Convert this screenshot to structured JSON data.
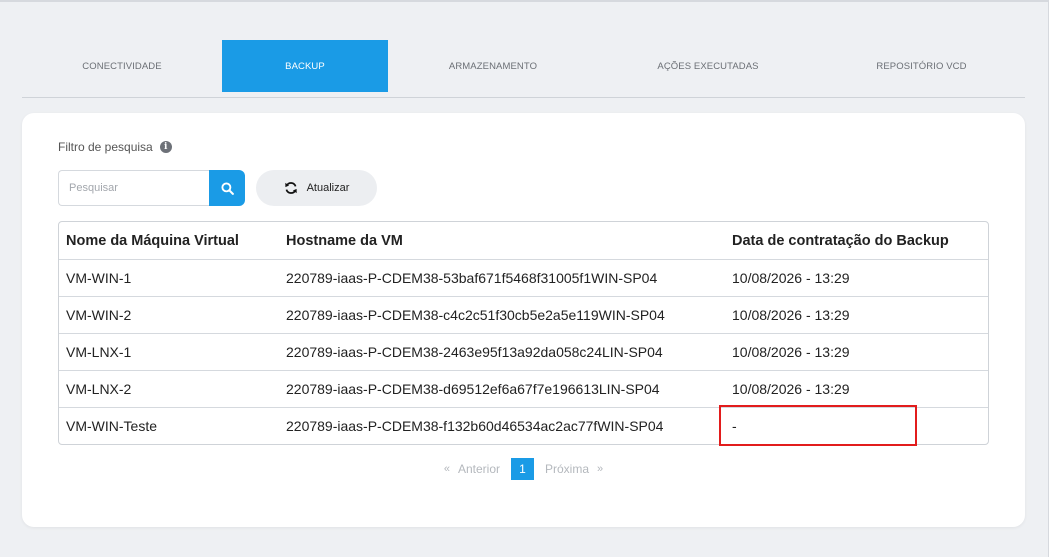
{
  "tabs": [
    {
      "label": "CONECTIVIDADE"
    },
    {
      "label": "BACKUP"
    },
    {
      "label": "ARMAZENAMENTO"
    },
    {
      "label": "AÇÕES EXECUTADAS"
    },
    {
      "label": "REPOSITÓRIO VCD"
    }
  ],
  "filter": {
    "label": "Filtro de pesquisa",
    "info_icon": "i",
    "search_placeholder": "Pesquisar",
    "refresh_label": "Atualizar"
  },
  "table": {
    "headers": [
      "Nome da Máquina Virtual",
      "Hostname da VM",
      "Data de contratação do Backup"
    ],
    "rows": [
      [
        "VM-WIN-1",
        "220789-iaas-P-CDEM38-53baf671f5468f31005f1WIN-SP04",
        "10/08/2026 - 13:29"
      ],
      [
        "VM-WIN-2",
        "220789-iaas-P-CDEM38-c4c2c51f30cb5e2a5e119WIN-SP04",
        "10/08/2026 - 13:29"
      ],
      [
        "VM-LNX-1",
        "220789-iaas-P-CDEM38-2463e95f13a92da058c24LIN-SP04",
        "10/08/2026 - 13:29"
      ],
      [
        "VM-LNX-2",
        "220789-iaas-P-CDEM38-d69512ef6a67f7e196613LIN-SP04",
        "10/08/2026 - 13:29"
      ],
      [
        "VM-WIN-Teste",
        "220789-iaas-P-CDEM38-f132b60d46534ac2ac77fWIN-SP04",
        "-"
      ]
    ]
  },
  "pagination": {
    "prev_arrow": "«",
    "prev_label": "Anterior",
    "current_page": "1",
    "next_label": "Próxima",
    "next_arrow": "»"
  },
  "colors": {
    "accent": "#1a9be6",
    "highlight": "#e21c1c"
  }
}
